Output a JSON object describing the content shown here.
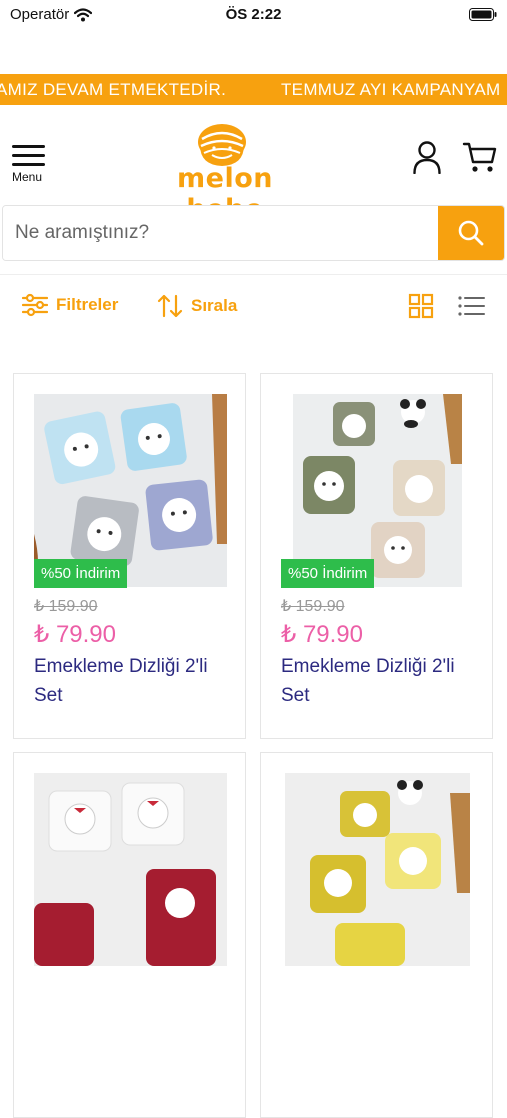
{
  "status_bar": {
    "carrier": "Operatör",
    "time": "ÖS 2:22"
  },
  "announcement": {
    "segment_1": "AMIZ DEVAM ETMEKTEDİR.",
    "segment_2": "TEMMUZ AYI KAMPANYAM"
  },
  "header": {
    "menu_label": "Menu",
    "logo_text": "melon bebe"
  },
  "search": {
    "placeholder": "Ne aramıştınız?"
  },
  "toolbar": {
    "filters_label": "Filtreler",
    "sort_label": "Sırala"
  },
  "products": [
    {
      "discount_badge": "%50 İndirim",
      "old_price": "₺ 159.90",
      "price": "₺ 79.90",
      "name": "Emekleme Dizliği 2'li Set"
    },
    {
      "discount_badge": "%50 İndirim",
      "old_price": "₺ 159.90",
      "price": "₺ 79.90",
      "name": "Emekleme Dizliği 2'li Set"
    },
    {
      "discount_badge": "",
      "old_price": "",
      "price": "",
      "name": ""
    },
    {
      "discount_badge": "",
      "old_price": "",
      "price": "",
      "name": ""
    }
  ],
  "colors": {
    "brand": "#f7a10f",
    "badge": "#2ebd4b",
    "price": "#ec5fa7",
    "product_name": "#2c2a80"
  }
}
